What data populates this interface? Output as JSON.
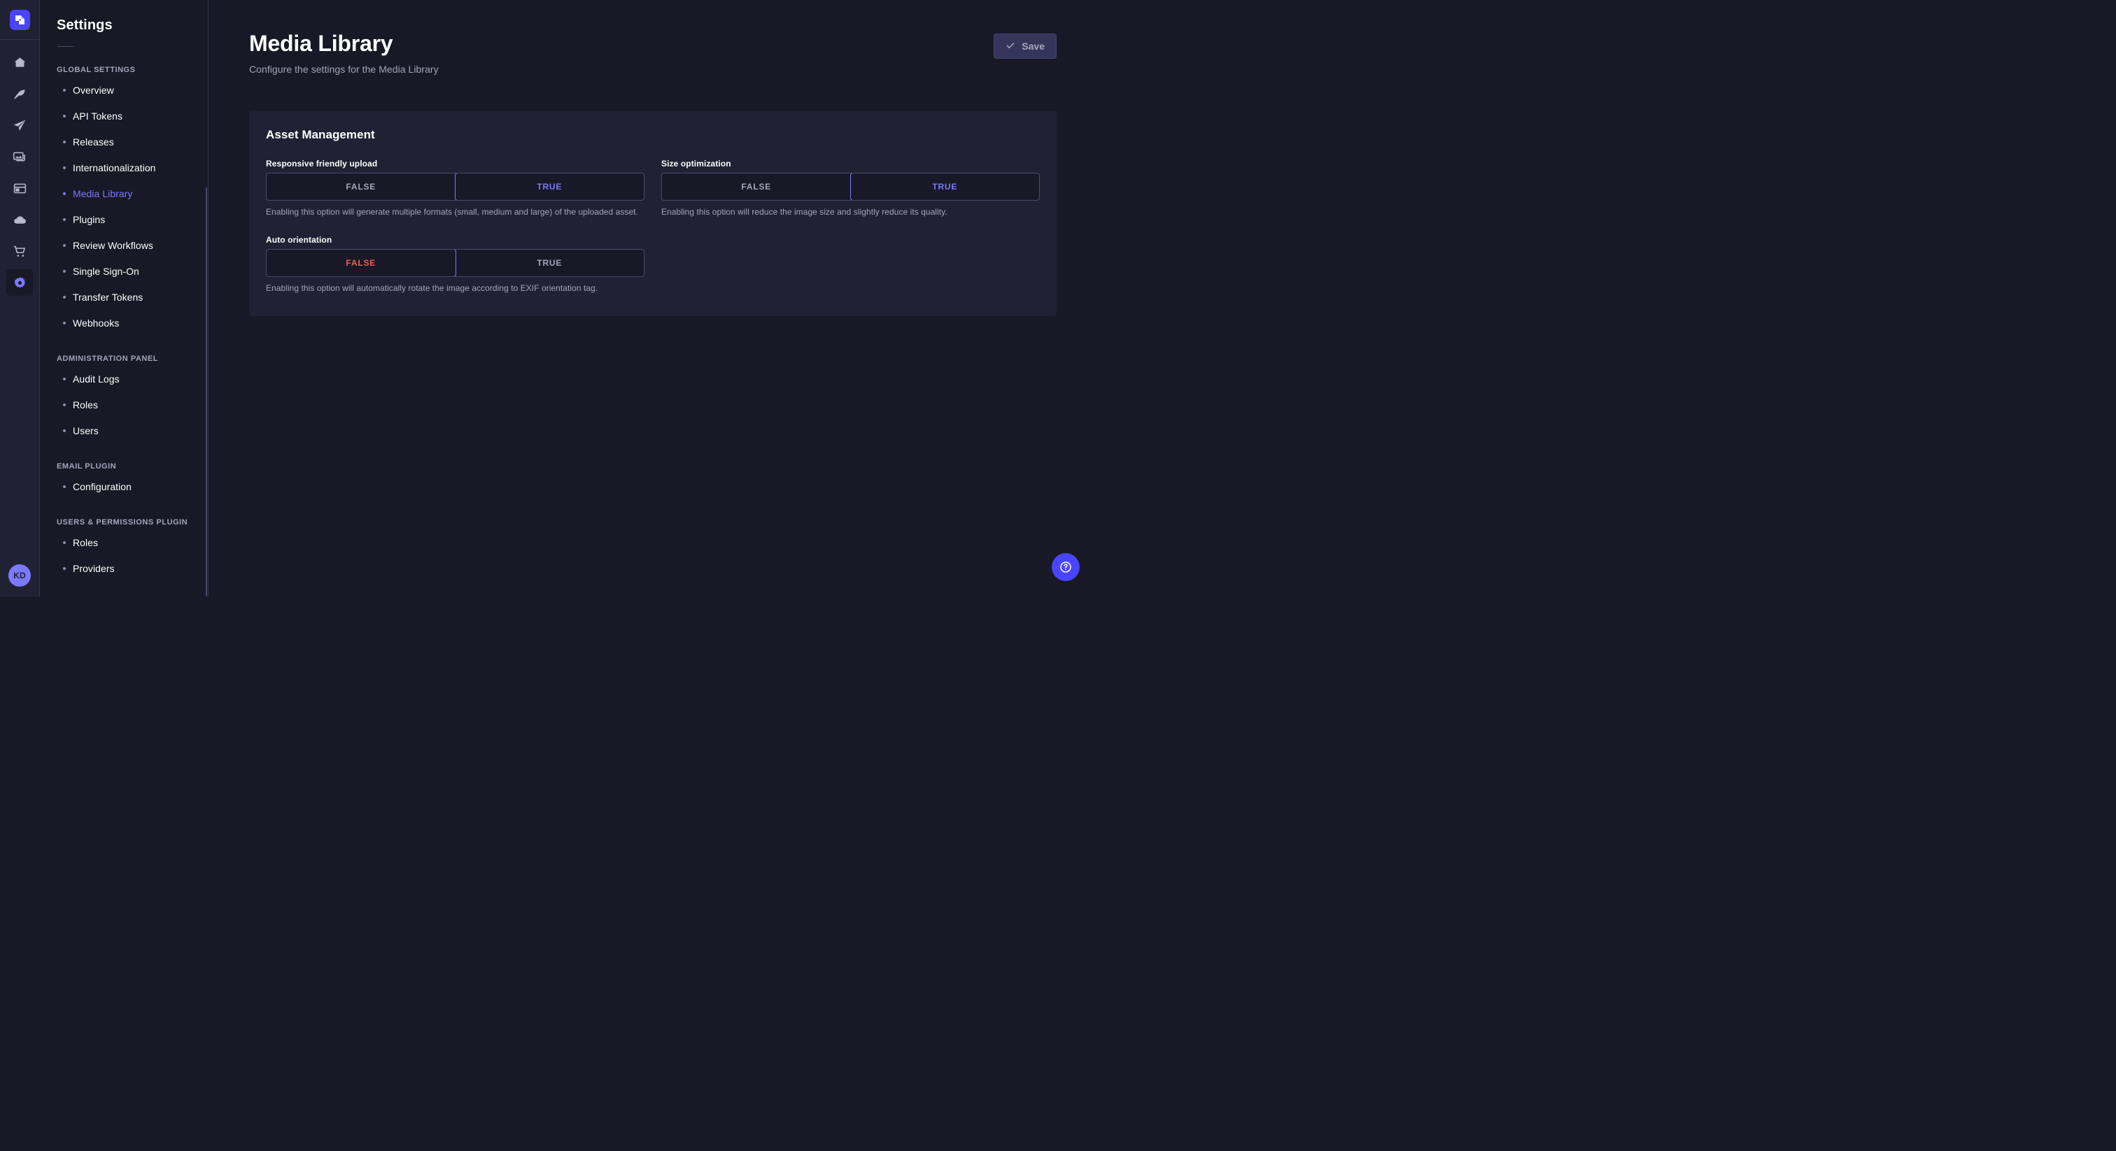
{
  "rail": {
    "logo_icon": "strapi-logo-icon",
    "items": [
      {
        "name": "home",
        "icon": "home-icon"
      },
      {
        "name": "content-manager",
        "icon": "feather-icon"
      },
      {
        "name": "content-type-builder",
        "icon": "paper-plane-icon"
      },
      {
        "name": "media-library",
        "icon": "images-icon"
      },
      {
        "name": "single-types",
        "icon": "layout-icon"
      },
      {
        "name": "cloud",
        "icon": "cloud-icon"
      },
      {
        "name": "marketplace",
        "icon": "shopping-cart-icon"
      },
      {
        "name": "settings",
        "icon": "gear-icon"
      }
    ],
    "avatar_initials": "KD"
  },
  "sidebar": {
    "title": "Settings",
    "sections": [
      {
        "label": "GLOBAL SETTINGS",
        "items": [
          {
            "label": "Overview",
            "active": false
          },
          {
            "label": "API Tokens",
            "active": false
          },
          {
            "label": "Releases",
            "active": false
          },
          {
            "label": "Internationalization",
            "active": false
          },
          {
            "label": "Media Library",
            "active": true
          },
          {
            "label": "Plugins",
            "active": false
          },
          {
            "label": "Review Workflows",
            "active": false
          },
          {
            "label": "Single Sign-On",
            "active": false
          },
          {
            "label": "Transfer Tokens",
            "active": false
          },
          {
            "label": "Webhooks",
            "active": false
          }
        ]
      },
      {
        "label": "ADMINISTRATION PANEL",
        "items": [
          {
            "label": "Audit Logs",
            "active": false
          },
          {
            "label": "Roles",
            "active": false
          },
          {
            "label": "Users",
            "active": false
          }
        ]
      },
      {
        "label": "EMAIL PLUGIN",
        "items": [
          {
            "label": "Configuration",
            "active": false
          }
        ]
      },
      {
        "label": "USERS & PERMISSIONS PLUGIN",
        "items": [
          {
            "label": "Roles",
            "active": false
          },
          {
            "label": "Providers",
            "active": false
          }
        ]
      }
    ]
  },
  "header": {
    "title": "Media Library",
    "subtitle": "Configure the settings for the Media Library",
    "save_label": "Save",
    "save_icon": "check-icon"
  },
  "card": {
    "title": "Asset Management",
    "fields": [
      {
        "label": "Responsive friendly upload",
        "false_label": "FALSE",
        "true_label": "TRUE",
        "selected": "TRUE",
        "hint": "Enabling this option will generate multiple formats (small, medium and large) of the uploaded asset."
      },
      {
        "label": "Size optimization",
        "false_label": "FALSE",
        "true_label": "TRUE",
        "selected": "TRUE",
        "hint": "Enabling this option will reduce the image size and slightly reduce its quality."
      },
      {
        "label": "Auto orientation",
        "false_label": "FALSE",
        "true_label": "TRUE",
        "selected": "FALSE",
        "hint": "Enabling this option will automatically rotate the image according to EXIF orientation tag."
      }
    ]
  },
  "help": {
    "icon": "question-mark-circle-icon"
  },
  "colors": {
    "accent": "#4945ff",
    "accent_light": "#7b79ff",
    "danger": "#ee5e52",
    "bg": "#181826",
    "surface": "#212134",
    "border": "#32324d",
    "text_muted": "#a5a5ba"
  }
}
